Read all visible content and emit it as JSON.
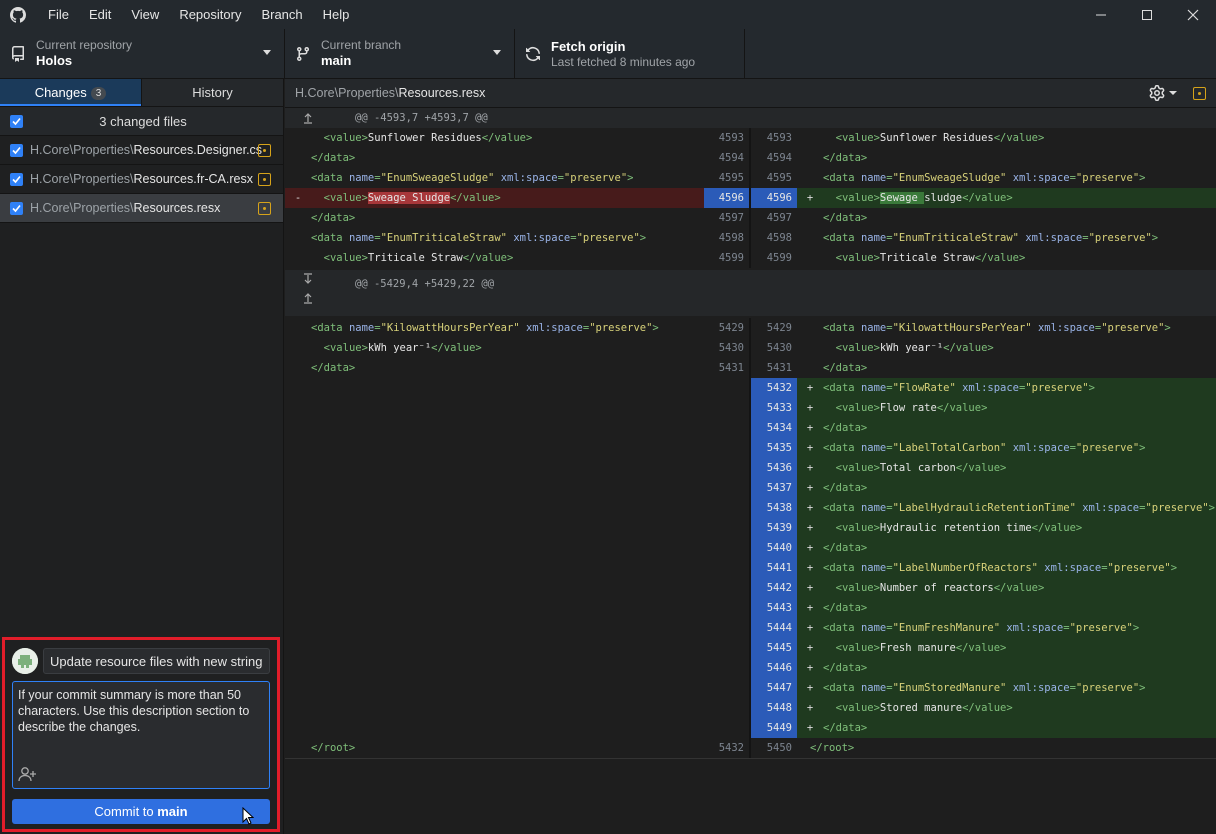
{
  "menu": [
    "File",
    "Edit",
    "View",
    "Repository",
    "Branch",
    "Help"
  ],
  "toolbar": {
    "repo_title": "Current repository",
    "repo_value": "Holos",
    "branch_title": "Current branch",
    "branch_value": "main",
    "fetch_title": "Fetch origin",
    "fetch_sub": "Last fetched 8 minutes ago"
  },
  "tabs": {
    "changes": "Changes",
    "changes_count": "3",
    "history": "History"
  },
  "changed_label": "3 changed files",
  "files": [
    {
      "dir": "H.Core\\Properties\\",
      "name": "Resources.Designer.cs"
    },
    {
      "dir": "H.Core\\Properties\\",
      "name": "Resources.fr-CA.resx"
    },
    {
      "dir": "H.Core\\Properties\\",
      "name": "Resources.resx"
    }
  ],
  "commit": {
    "summary": "Update resource files with new string",
    "description": "If your commit summary is more than 50 characters. Use this description section to describe the changes.",
    "button_prefix": "Commit to ",
    "button_branch": "main"
  },
  "diff_header": {
    "dir": "H.Core\\Properties\\",
    "name": "Resources.resx"
  },
  "hunks": [
    "@@ -4593,7 +4593,7 @@",
    "@@ -5429,4 +5429,22 @@"
  ],
  "colors": {
    "accent": "#2f81f7",
    "highlight_box": "#e11d2a",
    "modified": "#d6a31a"
  }
}
